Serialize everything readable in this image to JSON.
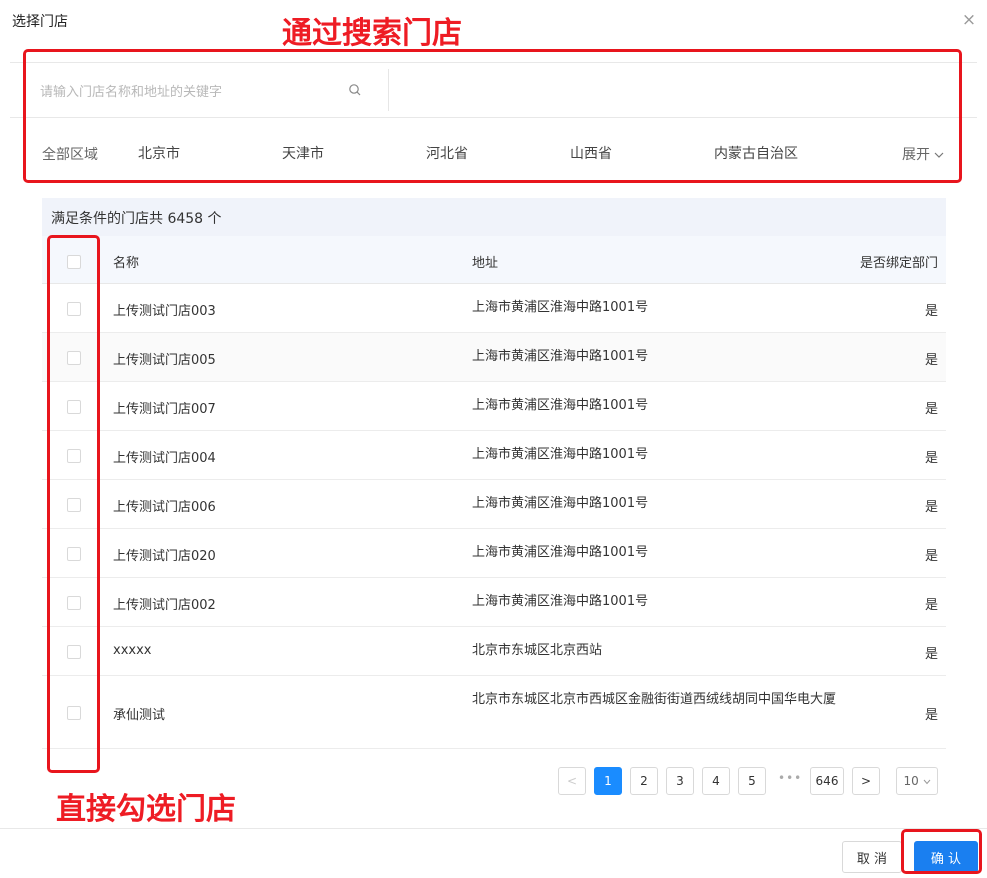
{
  "dialog": {
    "title": "选择门店",
    "close_icon": "×"
  },
  "annotations": {
    "search": "通过搜索门店",
    "select": "直接勾选门店"
  },
  "search": {
    "placeholder": "请输入门店名称和地址的关键字",
    "value": ""
  },
  "regions": {
    "label": "全部区域",
    "items": [
      "北京市",
      "天津市",
      "河北省",
      "山西省",
      "内蒙古自治区"
    ],
    "expand_label": "展开"
  },
  "summary": {
    "text": "满足条件的门店共 6458 个"
  },
  "table": {
    "columns": [
      "名称",
      "地址",
      "是否绑定部门"
    ],
    "rows": [
      {
        "name": "上传测试门店003",
        "address": "上海市黄浦区淮海中路1001号",
        "bound": "是"
      },
      {
        "name": "上传测试门店005",
        "address": "上海市黄浦区淮海中路1001号",
        "bound": "是"
      },
      {
        "name": "上传测试门店007",
        "address": "上海市黄浦区淮海中路1001号",
        "bound": "是"
      },
      {
        "name": "上传测试门店004",
        "address": "上海市黄浦区淮海中路1001号",
        "bound": "是"
      },
      {
        "name": "上传测试门店006",
        "address": "上海市黄浦区淮海中路1001号",
        "bound": "是"
      },
      {
        "name": "上传测试门店020",
        "address": "上海市黄浦区淮海中路1001号",
        "bound": "是"
      },
      {
        "name": "上传测试门店002",
        "address": "上海市黄浦区淮海中路1001号",
        "bound": "是"
      },
      {
        "name": "xxxxx",
        "address": "北京市东城区北京西站",
        "bound": "是"
      },
      {
        "name": "承仙测试",
        "address": "北京市东城区北京市西城区金融街街道西绒线胡同中国华电大厦",
        "bound": "是"
      }
    ]
  },
  "pagination": {
    "prev": "<",
    "pages": [
      "1",
      "2",
      "3",
      "4",
      "5"
    ],
    "current": "1",
    "ellipsis": "•••",
    "last": "646",
    "next": ">",
    "page_size": "10"
  },
  "footer": {
    "cancel_label": "取 消",
    "confirm_label": "确 认"
  },
  "colors": {
    "accent": "#1a8cff",
    "annotation": "#e8151d"
  }
}
